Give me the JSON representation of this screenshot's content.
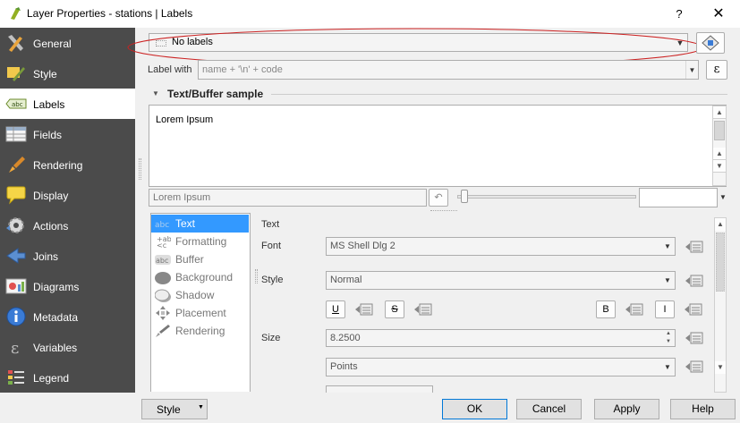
{
  "window": {
    "title": "Layer Properties - stations | Labels",
    "help": "?",
    "close": "✕"
  },
  "sidebar": {
    "items": [
      {
        "label": "General",
        "icon": "wrench-icon"
      },
      {
        "label": "Style",
        "icon": "paintbrush-icon"
      },
      {
        "label": "Labels",
        "icon": "abc-label-icon",
        "active": true
      },
      {
        "label": "Fields",
        "icon": "table-icon"
      },
      {
        "label": "Rendering",
        "icon": "brush-icon"
      },
      {
        "label": "Display",
        "icon": "speech-bubble-icon"
      },
      {
        "label": "Actions",
        "icon": "gear-icon"
      },
      {
        "label": "Joins",
        "icon": "join-arrow-icon"
      },
      {
        "label": "Diagrams",
        "icon": "diagram-icon"
      },
      {
        "label": "Metadata",
        "icon": "info-icon"
      },
      {
        "label": "Variables",
        "icon": "epsilon-icon"
      },
      {
        "label": "Legend",
        "icon": "legend-icon"
      }
    ]
  },
  "labels": {
    "mode": "No labels",
    "label_with_caption": "Label with",
    "label_with_value": "name + '\\n' + code",
    "expression_symbol": "ε",
    "sample_header": "Text/Buffer sample",
    "sample_text": "Lorem Ipsum",
    "sample_input": "Lorem Ipsum"
  },
  "subtabs": [
    {
      "label": "Text",
      "icon": "abc-text-icon",
      "active": true
    },
    {
      "label": "Formatting",
      "icon": "formatting-icon"
    },
    {
      "label": "Buffer",
      "icon": "abc-buffer-icon"
    },
    {
      "label": "Background",
      "icon": "background-icon"
    },
    {
      "label": "Shadow",
      "icon": "shadow-icon"
    },
    {
      "label": "Placement",
      "icon": "placement-icon"
    },
    {
      "label": "Rendering",
      "icon": "rendering-icon"
    }
  ],
  "text_panel": {
    "section": "Text",
    "font_label": "Font",
    "font_value": "MS Shell Dlg 2",
    "style_label": "Style",
    "style_value": "Normal",
    "underline": "U",
    "strike": "S",
    "bold": "B",
    "italic": "I",
    "size_label": "Size",
    "size_value": "8.2500",
    "units_value": "Points"
  },
  "buttons": {
    "style": "Style",
    "ok": "OK",
    "cancel": "Cancel",
    "apply": "Apply",
    "help": "Help"
  }
}
